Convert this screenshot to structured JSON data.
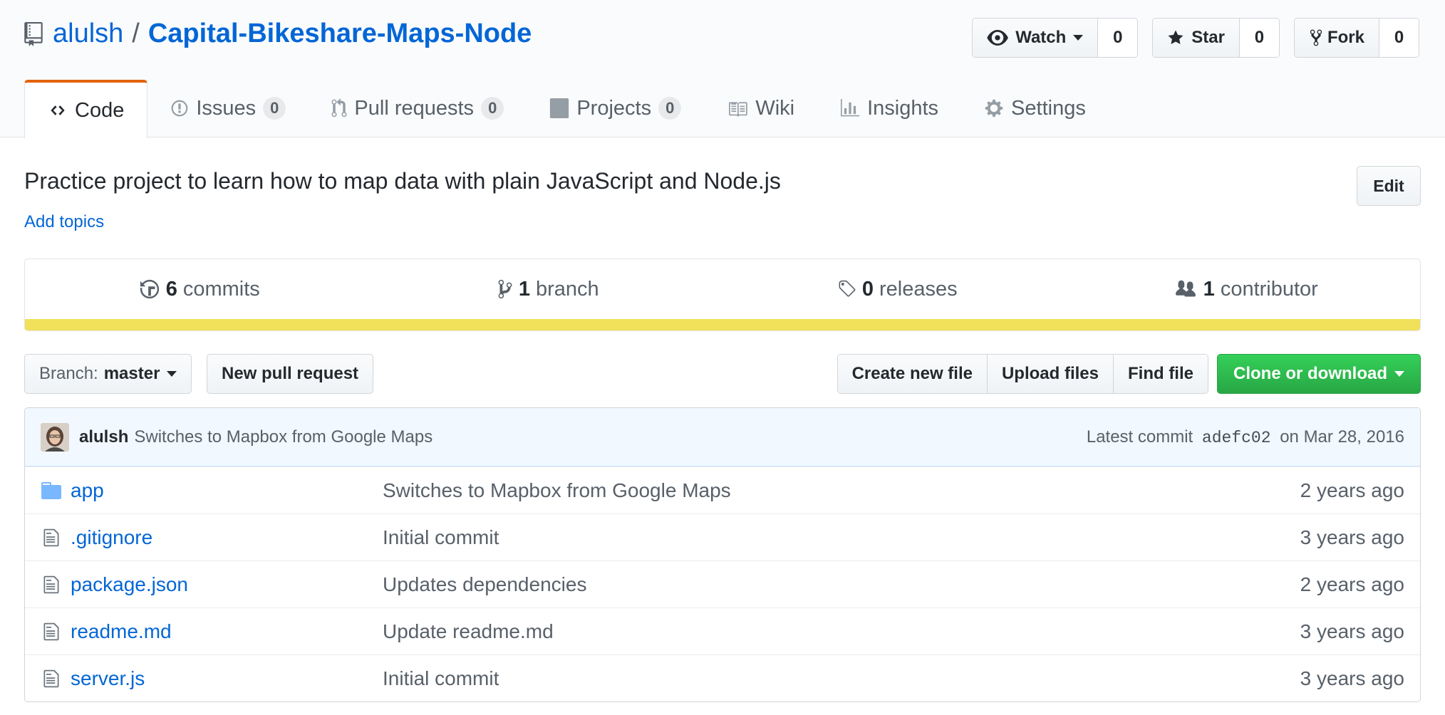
{
  "repo": {
    "owner": "alulsh",
    "separator": "/",
    "name": "Capital-Bikeshare-Maps-Node",
    "icon": "repo-icon"
  },
  "actions": {
    "watch": {
      "label": "Watch",
      "count": "0",
      "icon": "eye-icon"
    },
    "star": {
      "label": "Star",
      "count": "0",
      "icon": "star-icon"
    },
    "fork": {
      "label": "Fork",
      "count": "0",
      "icon": "fork-icon"
    }
  },
  "tabs": [
    {
      "label": "Code",
      "icon": "code-icon",
      "active": true
    },
    {
      "label": "Issues",
      "count": "0",
      "icon": "issue-icon"
    },
    {
      "label": "Pull requests",
      "count": "0",
      "icon": "pull-request-icon"
    },
    {
      "label": "Projects",
      "count": "0",
      "icon": "project-icon"
    },
    {
      "label": "Wiki",
      "icon": "book-icon"
    },
    {
      "label": "Insights",
      "icon": "graph-icon"
    },
    {
      "label": "Settings",
      "icon": "gear-icon"
    }
  ],
  "description": "Practice project to learn how to map data with plain JavaScript and Node.js",
  "add_topics": "Add topics",
  "edit_label": "Edit",
  "summary": {
    "commits": {
      "count": "6",
      "label": "commits"
    },
    "branches": {
      "count": "1",
      "label": "branch"
    },
    "releases": {
      "count": "0",
      "label": "releases"
    },
    "contributors": {
      "count": "1",
      "label": "contributor"
    },
    "language_color": "#f1e05a"
  },
  "file_nav": {
    "branch_prefix": "Branch:",
    "branch_name": "master",
    "new_pr": "New pull request",
    "create_file": "Create new file",
    "upload_files": "Upload files",
    "find_file": "Find file",
    "clone": "Clone or download"
  },
  "latest_commit": {
    "author": "alulsh",
    "message": "Switches to Mapbox from Google Maps",
    "prefix": "Latest commit",
    "sha": "adefc02",
    "date": "on Mar 28, 2016"
  },
  "files": [
    {
      "type": "folder",
      "name": "app",
      "message": "Switches to Mapbox from Google Maps",
      "age": "2 years ago"
    },
    {
      "type": "file",
      "name": ".gitignore",
      "message": "Initial commit",
      "age": "3 years ago"
    },
    {
      "type": "file",
      "name": "package.json",
      "message": "Updates dependencies",
      "age": "2 years ago"
    },
    {
      "type": "file",
      "name": "readme.md",
      "message": "Update readme.md",
      "age": "3 years ago"
    },
    {
      "type": "file",
      "name": "server.js",
      "message": "Initial commit",
      "age": "3 years ago"
    }
  ]
}
